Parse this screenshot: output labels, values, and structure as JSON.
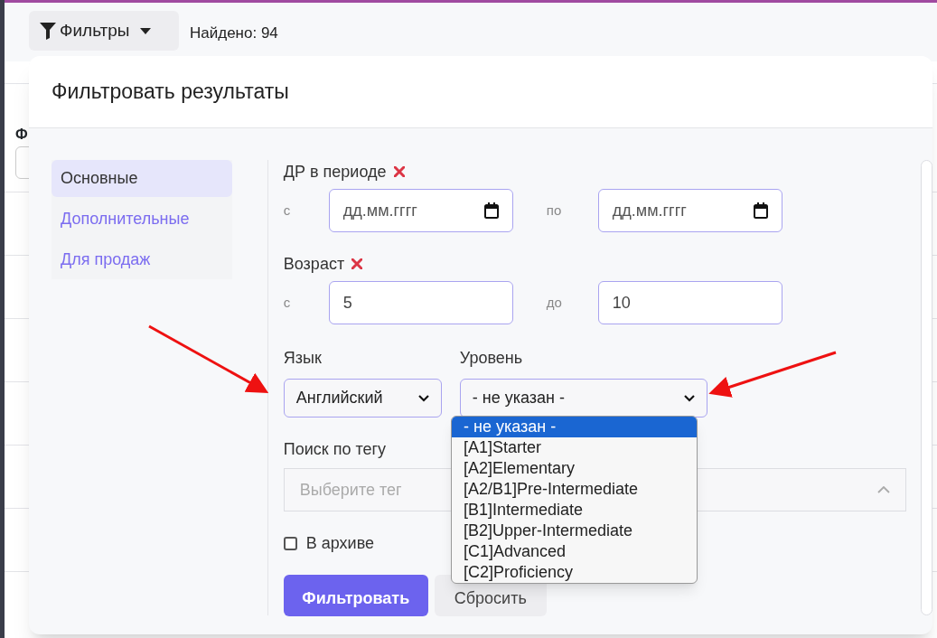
{
  "toolbar": {
    "filter_button": "Фильтры",
    "found": "Найдено: 94"
  },
  "background": {
    "header": "Ф"
  },
  "modal": {
    "title": "Фильтровать результаты",
    "tabs": [
      {
        "label": "Основные",
        "selected": true
      },
      {
        "label": "Дополнительные",
        "selected": false
      },
      {
        "label": "Для продаж",
        "selected": false
      }
    ],
    "birth_period": {
      "label": "ДР в периоде",
      "from_label": "с",
      "from_placeholder": "дд.мм.гггг",
      "to_label": "по",
      "to_placeholder": "дд.мм.гггг"
    },
    "age": {
      "label": "Возраст",
      "from_label": "с",
      "from_value": "5",
      "to_label": "до",
      "to_value": "10"
    },
    "language": {
      "label": "Язык",
      "value": "Английский"
    },
    "level": {
      "label": "Уровень",
      "value": "- не указан -",
      "expanded": true,
      "options": [
        {
          "label": "- не указан -",
          "selected": true
        },
        {
          "label": "[A1]Starter",
          "selected": false
        },
        {
          "label": "[A2]Elementary",
          "selected": false
        },
        {
          "label": "[A2/B1]Pre-Intermediate",
          "selected": false
        },
        {
          "label": "[B1]Intermediate",
          "selected": false
        },
        {
          "label": "[B2]Upper-Intermediate",
          "selected": false
        },
        {
          "label": "[C1]Advanced",
          "selected": false
        },
        {
          "label": "[C2]Proficiency",
          "selected": false
        }
      ]
    },
    "tag": {
      "label": "Поиск по тегу",
      "placeholder": "Выберите тег"
    },
    "archive": {
      "label": "В архиве",
      "checked": false
    },
    "buttons": [
      {
        "label": "Фильтровать",
        "kind": "primary"
      },
      {
        "label": "Сбросить",
        "kind": "secondary"
      }
    ]
  }
}
